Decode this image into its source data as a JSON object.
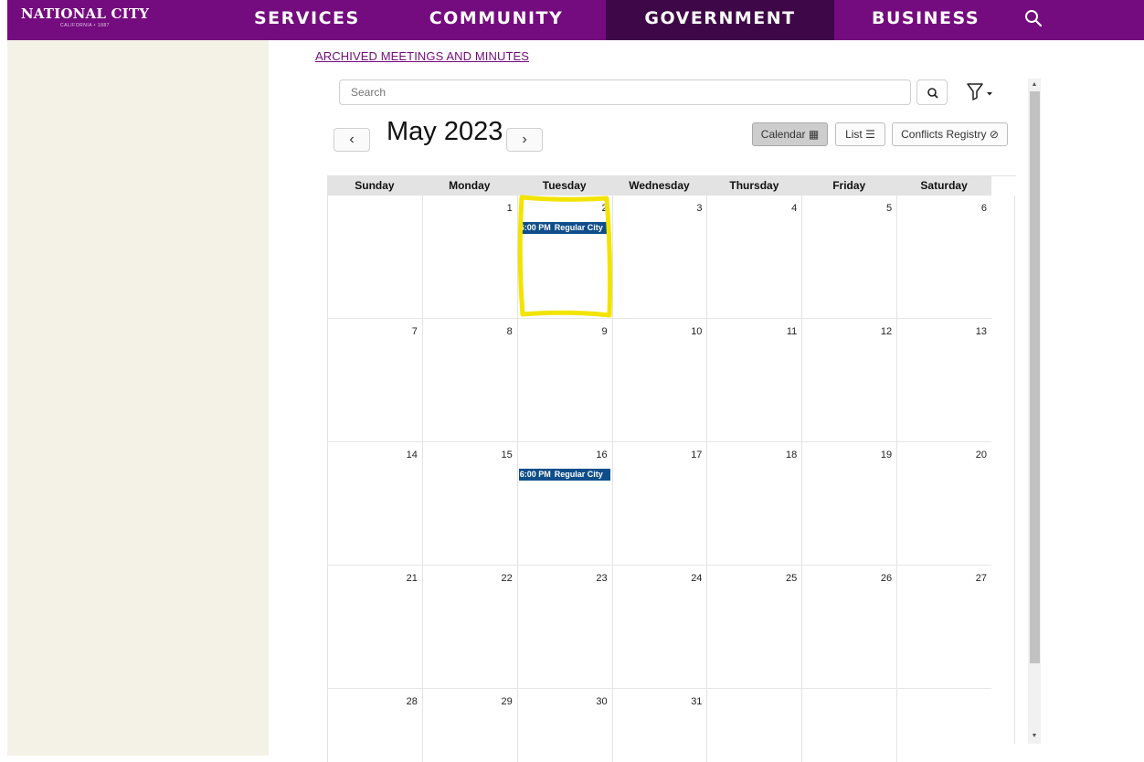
{
  "brand": {
    "name": "NATIONAL CITY",
    "tagline": "CALIFORNIA • 1887"
  },
  "nav": {
    "items": [
      {
        "label": "SERVICES"
      },
      {
        "label": "COMMUNITY"
      },
      {
        "label": "GOVERNMENT",
        "active": true
      },
      {
        "label": "BUSINESS"
      }
    ],
    "search_icon": "search-icon"
  },
  "colors": {
    "brand": "#740b7e",
    "active_nav": "#3e0747",
    "event": "#0f4e8a",
    "sidebar": "#f4f2e6",
    "highlight": "#f2e400"
  },
  "archive_link": "ARCHIVED MEETINGS AND MINUTES",
  "search": {
    "placeholder": "Search",
    "value": ""
  },
  "calendar": {
    "month_label": "May 2023",
    "prev_label": "‹",
    "next_label": "›",
    "views": {
      "calendar": "Calendar",
      "list": "List",
      "conflicts": "Conflicts Registry"
    },
    "weekdays": [
      "Sunday",
      "Monday",
      "Tuesday",
      "Wednesday",
      "Thursday",
      "Friday",
      "Saturday"
    ],
    "weeks": [
      [
        "",
        "1",
        "2",
        "3",
        "4",
        "5",
        "6"
      ],
      [
        "7",
        "8",
        "9",
        "10",
        "11",
        "12",
        "13"
      ],
      [
        "14",
        "15",
        "16",
        "17",
        "18",
        "19",
        "20"
      ],
      [
        "21",
        "22",
        "23",
        "24",
        "25",
        "26",
        "27"
      ],
      [
        "28",
        "29",
        "30",
        "31",
        "",
        "",
        ""
      ]
    ],
    "events": [
      {
        "day": "2",
        "time": "6:00 PM",
        "title": "Regular City"
      },
      {
        "day": "16",
        "time": "6:00 PM",
        "title": "Regular City"
      }
    ]
  }
}
